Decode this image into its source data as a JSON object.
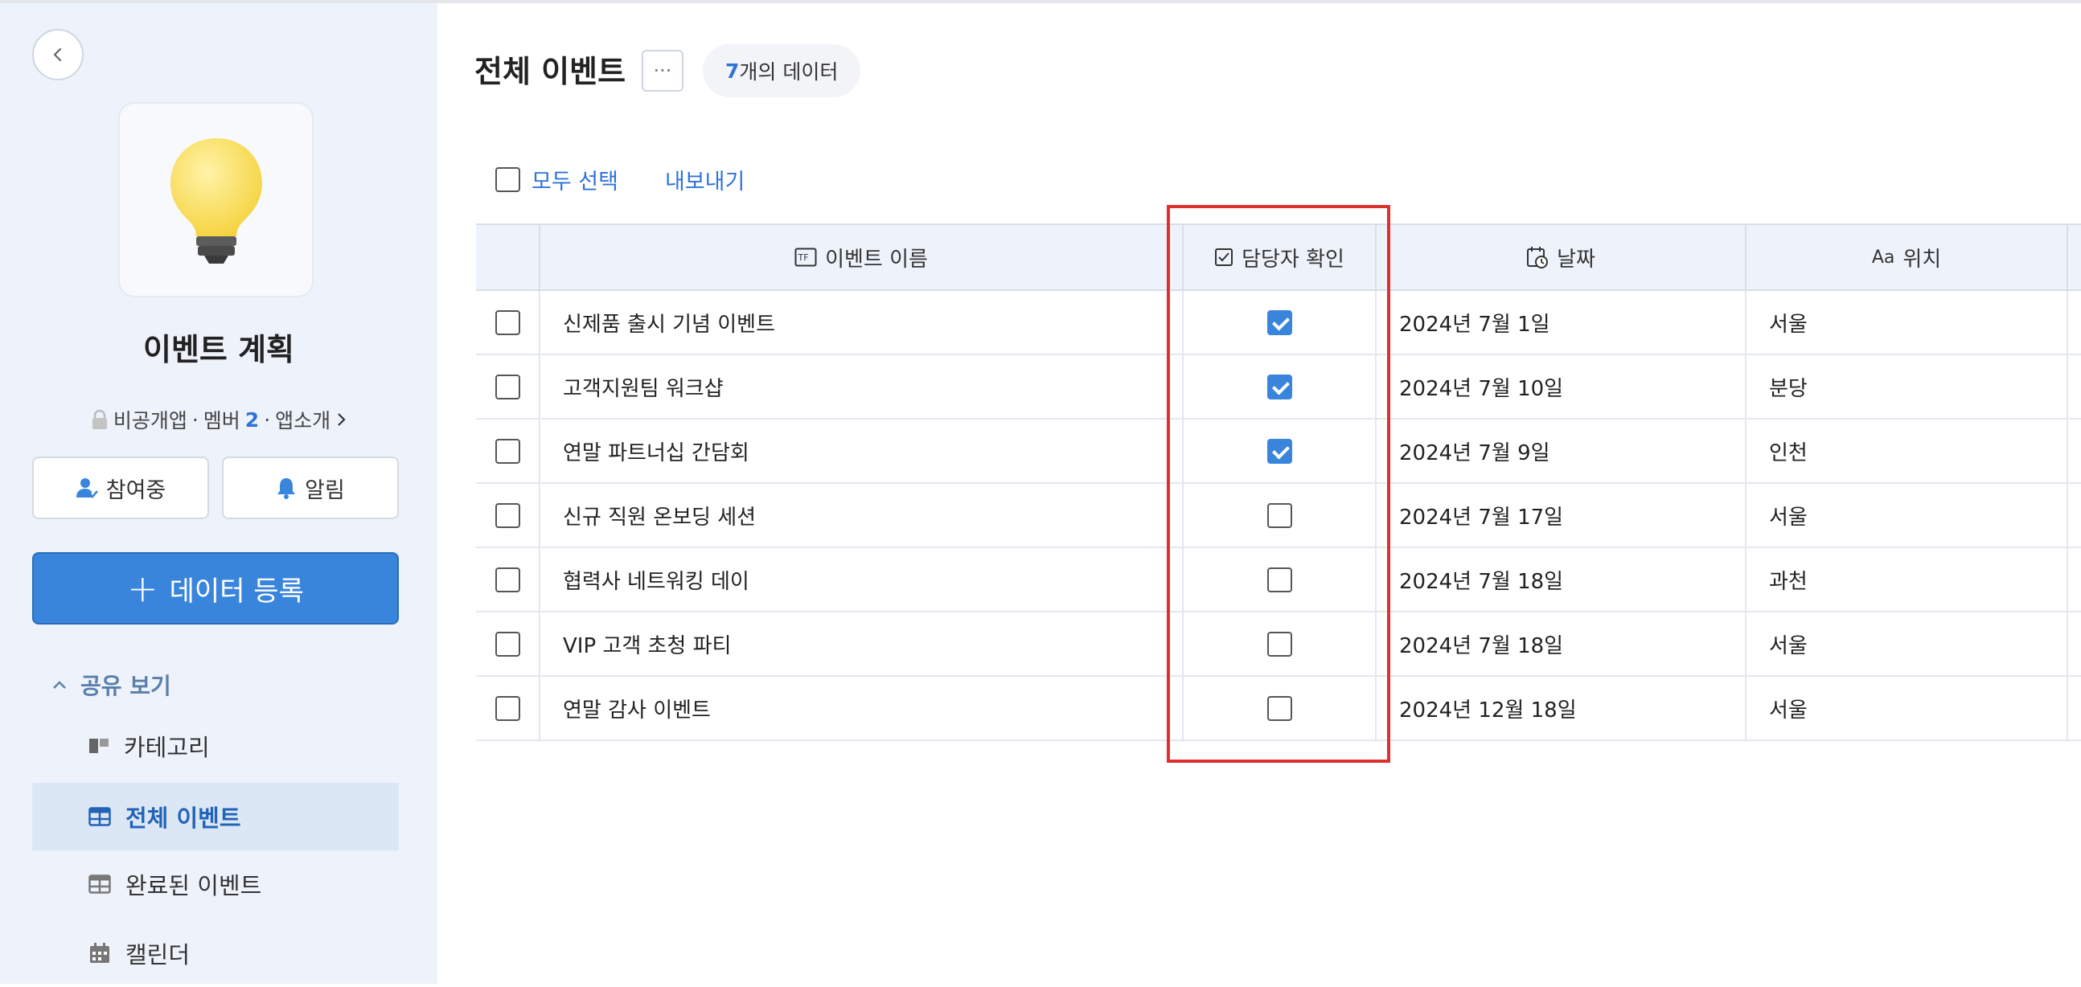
{
  "sidebar": {
    "app_title": "이벤트 계획",
    "meta": {
      "privacy": "비공개앱",
      "members_label": "멤버",
      "members_count": "2",
      "intro": "앱소개"
    },
    "join_label": "참여중",
    "alert_label": "알림",
    "register_label": "데이터 등록",
    "section_label": "공유 보기",
    "items": [
      {
        "label": "카테고리",
        "icon": "kanban-icon"
      },
      {
        "label": "전체 이벤트",
        "icon": "table-icon",
        "active": true
      },
      {
        "label": "완료된 이벤트",
        "icon": "table-icon"
      },
      {
        "label": "캘린더",
        "icon": "calendar-icon"
      }
    ]
  },
  "main": {
    "title": "전체 이벤트",
    "more_label": "···",
    "count": "7",
    "count_suffix": "개의 데이터",
    "select_all": "모두 선택",
    "export": "내보내기",
    "columns": {
      "name": "이벤트 이름",
      "confirm": "담당자 확인",
      "date": "날짜",
      "location": "위치",
      "location_icon_text": "Aa"
    },
    "rows": [
      {
        "name": "신제품 출시 기념 이벤트",
        "confirmed": true,
        "date": "2024년 7월 1일",
        "location": "서울"
      },
      {
        "name": "고객지원팀 워크샵",
        "confirmed": true,
        "date": "2024년 7월 10일",
        "location": "분당"
      },
      {
        "name": "연말 파트너십 간담회",
        "confirmed": true,
        "date": "2024년 7월 9일",
        "location": "인천"
      },
      {
        "name": "신규 직원 온보딩 세션",
        "confirmed": false,
        "date": "2024년 7월 17일",
        "location": "서울"
      },
      {
        "name": "협력사 네트워킹 데이",
        "confirmed": false,
        "date": "2024년 7월 18일",
        "location": "과천"
      },
      {
        "name": "VIP 고객 초청 파티",
        "confirmed": false,
        "date": "2024년 7월 18일",
        "location": "서울"
      },
      {
        "name": "연말 감사 이벤트",
        "confirmed": false,
        "date": "2024년 12월 18일",
        "location": "서울"
      }
    ]
  },
  "colors": {
    "accent": "#3a85dc",
    "highlight": "#e02f2f",
    "sidebar_bg": "#eef3fb"
  }
}
